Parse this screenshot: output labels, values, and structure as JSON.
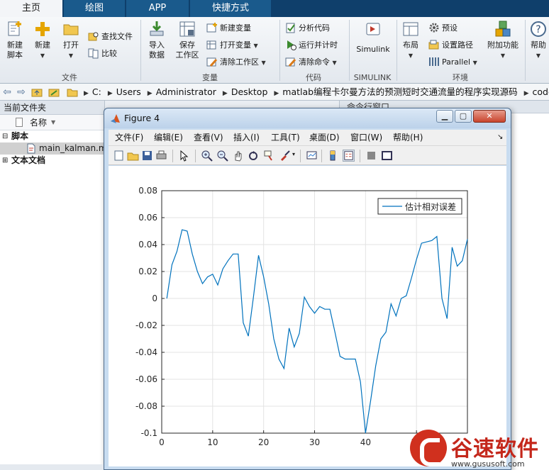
{
  "tabs": [
    {
      "label": "主页",
      "active": true
    },
    {
      "label": "绘图",
      "active": false
    },
    {
      "label": "APP",
      "active": false
    },
    {
      "label": "快捷方式",
      "active": false
    }
  ],
  "ribbon": {
    "file": {
      "label": "文件",
      "new_script": "新建\n脚本",
      "new": "新建",
      "open": "打开",
      "find_files": "查找文件",
      "compare": "比较"
    },
    "variable": {
      "label": "变量",
      "import": "导入\n数据",
      "save_ws": "保存\n工作区",
      "new_var": "新建变量",
      "open_var": "打开变量",
      "clear_ws": "清除工作区"
    },
    "code": {
      "label": "代码",
      "analyze": "分析代码",
      "run_time": "运行并计时",
      "clear_cmd": "清除命令"
    },
    "simulink": {
      "label": "SIMULINK",
      "button": "Simulink"
    },
    "env": {
      "label": "环境",
      "layout": "布局",
      "prefs": "预设",
      "set_path": "设置路径",
      "parallel": "Parallel",
      "addons": "附加功能"
    },
    "help": "帮助"
  },
  "address": {
    "crumbs": [
      "C:",
      "Users",
      "Administrator",
      "Desktop",
      "matlab编程卡尔曼方法的预测短时交通流量的程序实现源码",
      "code"
    ]
  },
  "folder_panel": {
    "title": "当前文件夹",
    "col_name": "名称",
    "groups": [
      {
        "label": "脚本",
        "items": [
          "main_kalman.m"
        ]
      },
      {
        "label": "文本文档",
        "items": []
      }
    ]
  },
  "right_panel": {
    "title": "命令行窗口"
  },
  "figure": {
    "title": "Figure 4",
    "menus": [
      "文件(F)",
      "编辑(E)",
      "查看(V)",
      "插入(I)",
      "工具(T)",
      "桌面(D)",
      "窗口(W)",
      "帮助(H)"
    ]
  },
  "chart_data": {
    "type": "line",
    "title": "",
    "xlabel": "",
    "ylabel": "",
    "xlim": [
      0,
      60
    ],
    "ylim": [
      -0.1,
      0.08
    ],
    "xticks": [
      0,
      10,
      20,
      30,
      40,
      50
    ],
    "yticks": [
      -0.1,
      -0.08,
      -0.06,
      -0.04,
      -0.02,
      0,
      0.02,
      0.04,
      0.06,
      0.08
    ],
    "ytick_labels": [
      "-0.1",
      "-0.08",
      "-0.06",
      "-0.04",
      "-0.02",
      "0",
      "0.02",
      "0.04",
      "0.06",
      "0.08"
    ],
    "grid": true,
    "legend_position": "top-right",
    "series": [
      {
        "name": "估计相对误差",
        "color": "#0072bd",
        "x": [
          1,
          2,
          3,
          4,
          5,
          6,
          7,
          8,
          9,
          10,
          11,
          12,
          13,
          14,
          15,
          16,
          17,
          18,
          19,
          20,
          21,
          22,
          23,
          24,
          25,
          26,
          27,
          28,
          29,
          30,
          31,
          32,
          33,
          34,
          35,
          36,
          37,
          38,
          39,
          40,
          41,
          42,
          43,
          44,
          45,
          46,
          47,
          48,
          49,
          50,
          51,
          52,
          53,
          54,
          55,
          56,
          57,
          58,
          59,
          60
        ],
        "y": [
          0.0,
          0.025,
          0.035,
          0.051,
          0.05,
          0.033,
          0.02,
          0.011,
          0.016,
          0.018,
          0.01,
          0.022,
          0.028,
          0.033,
          0.033,
          -0.018,
          -0.028,
          0.001,
          0.032,
          0.016,
          -0.004,
          -0.03,
          -0.045,
          -0.052,
          -0.022,
          -0.036,
          -0.026,
          0.001,
          -0.006,
          -0.011,
          -0.006,
          -0.008,
          -0.008,
          -0.025,
          -0.043,
          -0.045,
          -0.045,
          -0.045,
          -0.062,
          -0.1,
          -0.076,
          -0.05,
          -0.03,
          -0.025,
          -0.004,
          -0.013,
          0.0,
          0.002,
          0.015,
          0.029,
          0.041,
          0.042,
          0.043,
          0.046,
          0.0,
          -0.015,
          0.038,
          0.024,
          0.028,
          0.044
        ]
      }
    ]
  },
  "watermark": {
    "name": "谷速软件",
    "url": "www.gususoft.com"
  }
}
